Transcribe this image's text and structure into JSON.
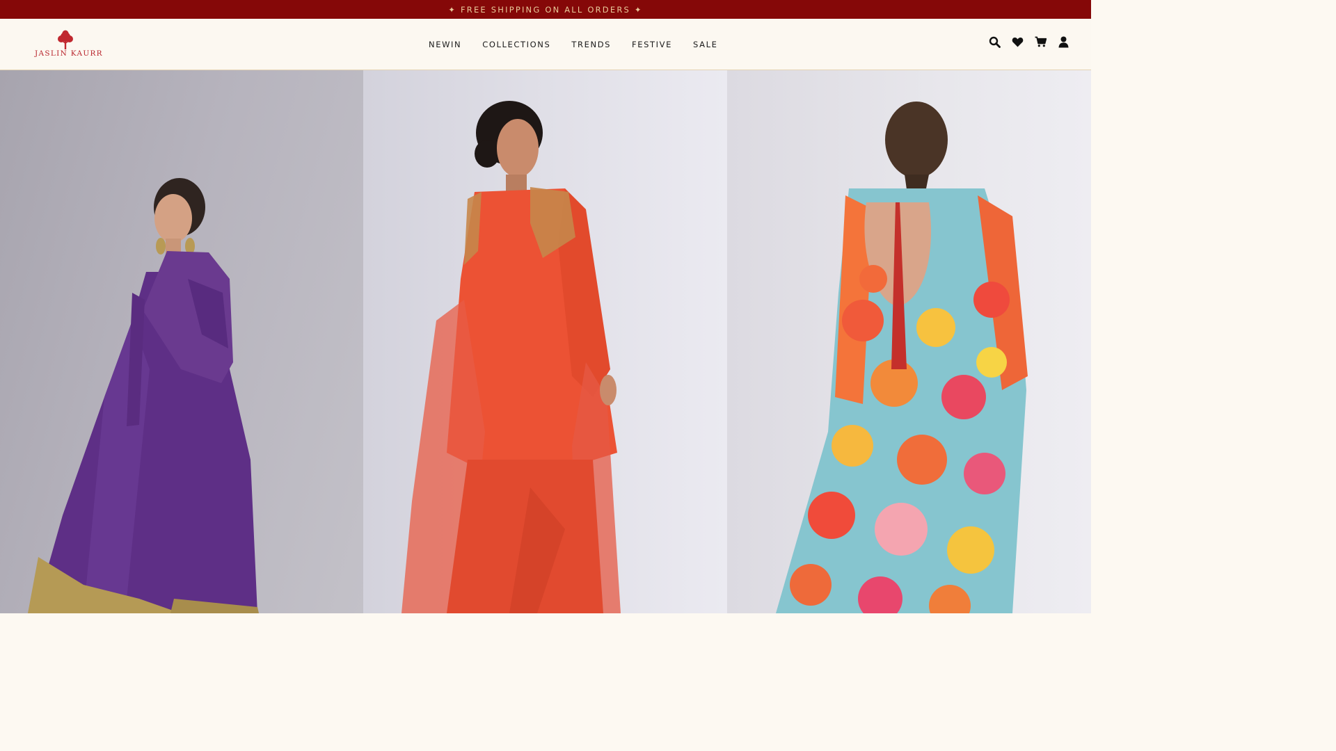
{
  "announcement": {
    "text": "✦ FREE SHIPPING ON ALL ORDERS ✦"
  },
  "brand": {
    "name": "JASLIN KAURR"
  },
  "nav": {
    "items": [
      {
        "label": "NEWIN"
      },
      {
        "label": "COLLECTIONS"
      },
      {
        "label": "TRENDS"
      },
      {
        "label": "FESTIVE"
      },
      {
        "label": "SALE"
      }
    ]
  },
  "header_icons": [
    "search-icon",
    "wishlist-heart-icon",
    "cart-icon",
    "account-icon"
  ],
  "hero": {
    "panels": [
      {
        "subject": "model in purple anarkali with dupatta",
        "garment_color": "#6a3a8f"
      },
      {
        "subject": "model in coral kurta set with sheer dupatta",
        "garment_color": "#ec5234"
      },
      {
        "subject": "model in floral print kaftan, back view",
        "garment_color": "#f26a3a"
      }
    ]
  },
  "colors": {
    "announcement_bg": "#850808",
    "announcement_text": "#e8c99a",
    "header_bg": "#fcf8f1",
    "brand_red": "#b8232b",
    "nav_text": "#1a1a1a"
  }
}
